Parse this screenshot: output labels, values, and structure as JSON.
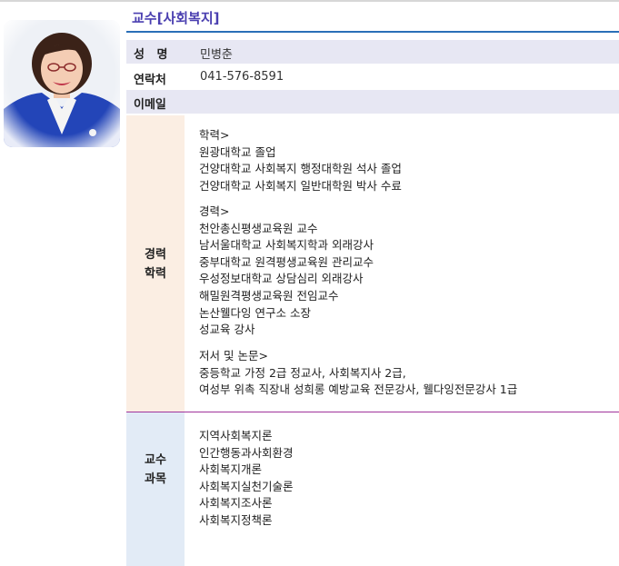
{
  "title": "교수[사회복지]",
  "profile": {
    "name_label": "성   명",
    "name_value": "민병춘",
    "phone_label": "연락처",
    "phone_value": "041-576-8591",
    "email_label": "이메일",
    "email_value": ""
  },
  "career": {
    "side_label_1": "경력",
    "side_label_2": "학력",
    "education_header": "학력>",
    "education": [
      "원광대학교 졸업",
      "건양대학교 사회복지 행정대학원 석사 졸업",
      "건양대학교 사회복지 일반대학원 박사 수료"
    ],
    "experience_header": "경력>",
    "experience": [
      "천안총신평생교육원 교수",
      "남서울대학교 사회복지학과 외래강사",
      "중부대학교 원격평생교육원 관리교수",
      "우성정보대학교 상담심리 외래강사",
      "해밀원격평생교육원 전임교수",
      "논산웰다잉 연구소 소장",
      "성교육 강사"
    ],
    "publications_header": "저서 및 논문>",
    "publications": [
      "중등학교 가정 2급 정교사, 사회복지사 2급,",
      "여성부 위촉 직장내 성희롱 예방교육 전문강사, 웰다잉전문강사 1급"
    ]
  },
  "courses": {
    "side_label_1": "교수",
    "side_label_2": "과목",
    "items": [
      "지역사회복지론",
      "인간행동과사회환경",
      "사회복지개론",
      "사회복지실천기술론",
      "사회복지조사론",
      "사회복지정책론"
    ]
  },
  "colors": {
    "title": "#4a3fb0",
    "rule": "#2a6fb7",
    "row_shade": "#e7e7f3",
    "career_side": "#fbeee3",
    "course_side": "#e2ebf6",
    "divider": "#a0339c"
  }
}
